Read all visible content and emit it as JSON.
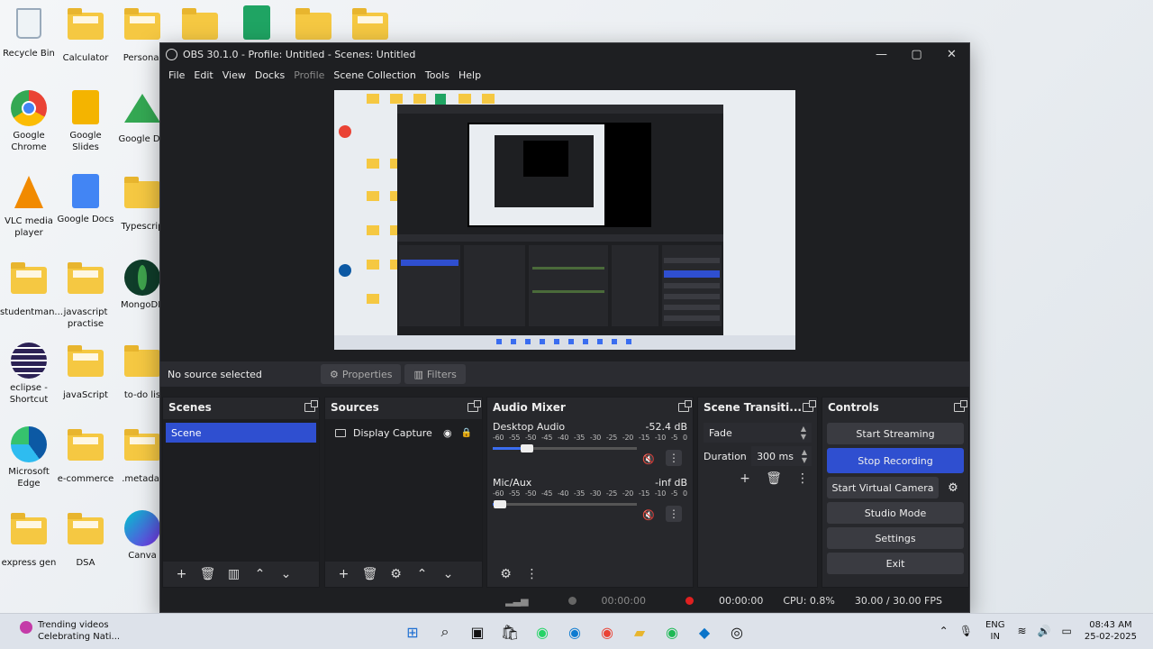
{
  "desktop": {
    "icons": [
      {
        "label": "Recycle Bin",
        "icon": "recycle-bin-icon"
      },
      {
        "label": "Calculator",
        "icon": "folder-icon"
      },
      {
        "label": "Personal",
        "icon": "folder-icon"
      },
      {
        "label": "Google Chrome",
        "icon": "chrome-icon"
      },
      {
        "label": "Google Slides",
        "icon": "google-slides-icon"
      },
      {
        "label": "Google Dri",
        "icon": "google-drive-icon"
      },
      {
        "label": "VLC media player",
        "icon": "vlc-icon"
      },
      {
        "label": "Google Docs",
        "icon": "google-docs-icon"
      },
      {
        "label": "Typescrip",
        "icon": "folder-icon"
      },
      {
        "label": "studentman...",
        "icon": "folder-icon"
      },
      {
        "label": "javascript practise",
        "icon": "folder-icon"
      },
      {
        "label": "MongoDB",
        "icon": "mongodb-icon"
      },
      {
        "label": "eclipse - Shortcut",
        "icon": "eclipse-icon"
      },
      {
        "label": "javaScript",
        "icon": "folder-icon"
      },
      {
        "label": "to-do lis",
        "icon": "folder-icon"
      },
      {
        "label": "Microsoft Edge",
        "icon": "edge-icon"
      },
      {
        "label": "e-commerce",
        "icon": "folder-icon"
      },
      {
        "label": ".metadat",
        "icon": "folder-icon"
      },
      {
        "label": "express gen",
        "icon": "folder-icon"
      },
      {
        "label": "DSA",
        "icon": "folder-icon"
      },
      {
        "label": "Canva",
        "icon": "canva-icon"
      }
    ]
  },
  "window": {
    "title": "OBS 30.1.0 - Profile: Untitled - Scenes: Untitled",
    "controls": {
      "minimize": "—",
      "maximize": "▢",
      "close": "✕"
    }
  },
  "menu": [
    "File",
    "Edit",
    "View",
    "Docks",
    "Profile",
    "Scene Collection",
    "Tools",
    "Help"
  ],
  "source_toolbar": {
    "status": "No source selected",
    "properties": "Properties",
    "filters": "Filters"
  },
  "scenes": {
    "title": "Scenes",
    "items": [
      "Scene"
    ]
  },
  "sources": {
    "title": "Sources",
    "items": [
      "Display Capture"
    ]
  },
  "audio_mixer": {
    "title": "Audio Mixer",
    "ticks": [
      "-60",
      "-55",
      "-50",
      "-45",
      "-40",
      "-35",
      "-30",
      "-25",
      "-20",
      "-15",
      "-10",
      "-5",
      "0"
    ],
    "channels": [
      {
        "name": "Desktop Audio",
        "level": "-52.4 dB",
        "volume": 0.24
      },
      {
        "name": "Mic/Aux",
        "level": "-inf dB",
        "volume": 0.05
      }
    ]
  },
  "transitions": {
    "title": "Scene Transiti...",
    "selected": "Fade",
    "duration_label": "Duration",
    "duration_value": "300 ms"
  },
  "controls": {
    "title": "Controls",
    "start_streaming": "Start Streaming",
    "stop_recording": "Stop Recording",
    "start_virtual_camera": "Start Virtual Camera",
    "studio_mode": "Studio Mode",
    "settings": "Settings",
    "exit": "Exit"
  },
  "status": {
    "stream_time": "00:00:00",
    "record_time": "00:00:00",
    "cpu": "CPU: 0.8%",
    "fps": "30.00 / 30.00 FPS"
  },
  "taskbar": {
    "news_title": "Trending videos",
    "news_sub": "Celebrating Nati...",
    "lang_top": "ENG",
    "lang_bottom": "IN",
    "time": "08:43 AM",
    "date": "25-02-2025"
  },
  "colors": {
    "accent": "#2f4fd0",
    "record": "#e02020",
    "window_bg": "#1e1f22",
    "dock_bg": "#27282c"
  }
}
